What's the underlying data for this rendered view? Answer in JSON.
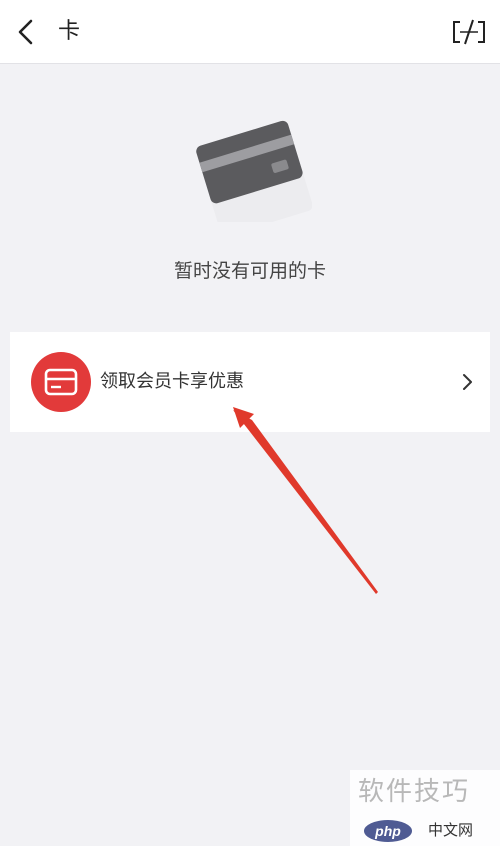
{
  "header": {
    "back_icon": "chevron-left-icon",
    "title": "卡",
    "scan_icon": "scan-icon"
  },
  "empty_state": {
    "illustration_icon": "bank-card-icon",
    "message": "暂时没有可用的卡"
  },
  "member_card": {
    "icon": "card-icon",
    "label": "领取会员卡享优惠",
    "chevron_icon": "chevron-right-icon",
    "accent_color": "#e23a3a"
  },
  "annotation": {
    "arrow_color": "#e0392b"
  },
  "watermark": {
    "text": "软件技巧",
    "logo_text": "php",
    "sub_text": "中文网"
  }
}
